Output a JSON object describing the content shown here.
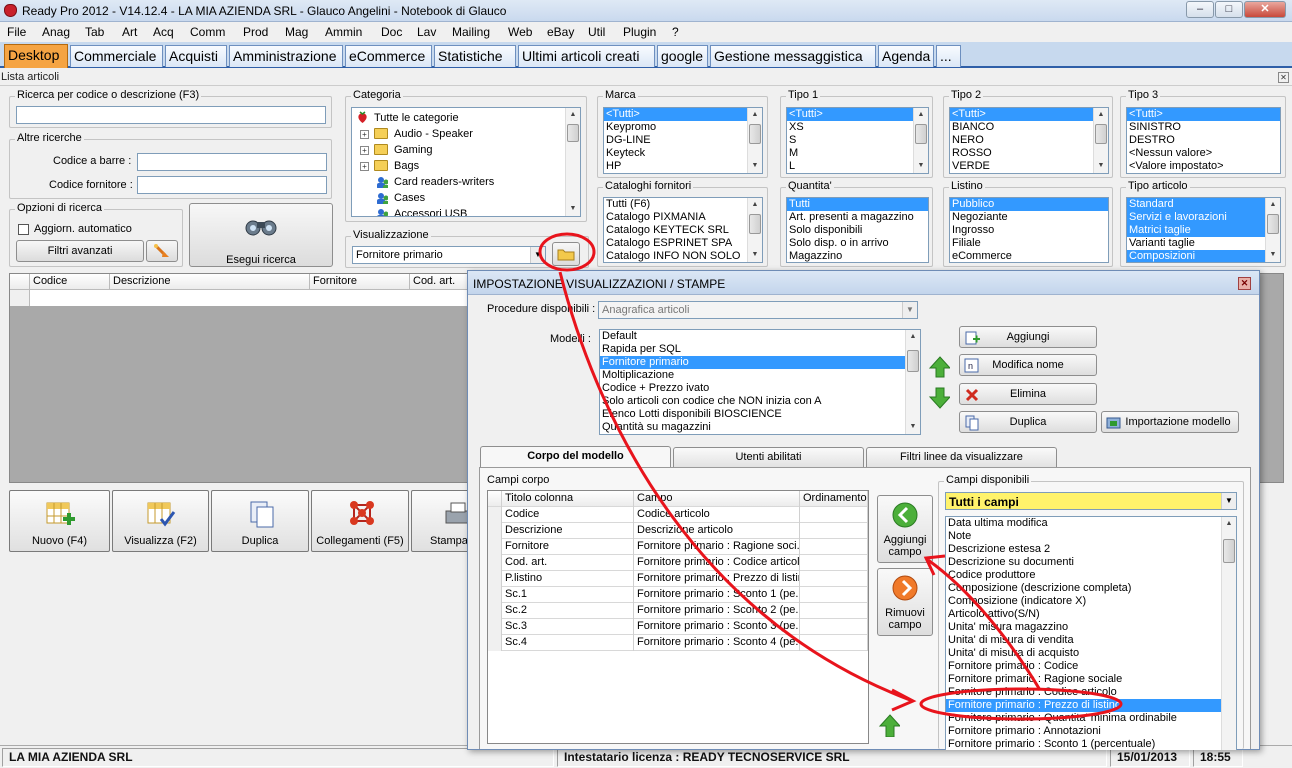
{
  "window": {
    "title": "Ready Pro 2012 - V14.12.4 - LA MIA AZIENDA SRL - Glauco Angelini - Notebook di Glauco",
    "controls": [
      "–",
      "□",
      "✕"
    ]
  },
  "menu": [
    "File",
    "Anag",
    "Tab",
    "Art",
    "Acq",
    "Comm",
    "Prod",
    "Mag",
    "Ammin",
    "Doc",
    "Lav",
    "Mailing",
    "Web",
    "eBay",
    "Util",
    "Plugin",
    "?"
  ],
  "tabs": [
    "Desktop",
    "Commerciale",
    "Acquisti",
    "Amministrazione",
    "eCommerce",
    "Statistiche",
    "Ultimi articoli creati",
    "google",
    "Gestione messaggistica",
    "Agenda",
    "..."
  ],
  "list_window": {
    "title": "Lista articoli"
  },
  "search": {
    "group_label": "Ricerca per codice o descrizione (F3)",
    "value": "",
    "other_label": "Altre ricerche",
    "barcode_label": "Codice a barre :",
    "supplier_code_label": "Codice fornitore :",
    "options_label": "Opzioni di ricerca",
    "auto_update_label": "Aggiorn. automatico",
    "advanced_filters_label": "Filtri avanzati",
    "run_label": "Esegui ricerca"
  },
  "category": {
    "label": "Categoria",
    "nodes": [
      "Tutte le categorie",
      "Audio - Speaker",
      "Gaming",
      "Bags",
      "Card readers-writers",
      "Cases",
      "Accessori USB"
    ]
  },
  "visualization": {
    "label": "Visualizzazione",
    "value": "Fornitore primario"
  },
  "filters": {
    "marca": {
      "label": "Marca",
      "items": [
        "<Tutti>",
        "Keypromo",
        "DG-LINE",
        "Keyteck",
        "HP"
      ],
      "selected": [
        0
      ]
    },
    "tipo1": {
      "label": "Tipo 1",
      "items": [
        "<Tutti>",
        "XS",
        "S",
        "M",
        "L"
      ],
      "selected": [
        0
      ]
    },
    "tipo2": {
      "label": "Tipo 2",
      "items": [
        "<Tutti>",
        "BIANCO",
        "NERO",
        "ROSSO",
        "VERDE"
      ],
      "selected": [
        0
      ]
    },
    "tipo3": {
      "label": "Tipo 3",
      "items": [
        "<Tutti>",
        "SINISTRO",
        "DESTRO",
        "<Nessun valore>",
        "<Valore impostato>"
      ],
      "selected": [
        0
      ]
    },
    "cataloghi": {
      "label": "Cataloghi fornitori",
      "items": [
        "Tutti (F6)",
        "Catalogo PIXMANIA",
        "Catalogo KEYTECK SRL",
        "Catalogo ESPRINET SPA",
        "Catalogo INFO NON SOLO"
      ],
      "selected": []
    },
    "quantita": {
      "label": "Quantita'",
      "items": [
        "Tutti",
        "Art. presenti a magazzino",
        "Solo disponibili",
        "Solo disp. o in arrivo",
        "Magazzino"
      ],
      "selected": [
        0
      ]
    },
    "listino": {
      "label": "Listino",
      "items": [
        "Pubblico",
        "Negoziante",
        "Ingrosso",
        "Filiale",
        "eCommerce"
      ],
      "selected": [
        0
      ]
    },
    "tipo_articolo": {
      "label": "Tipo articolo",
      "items": [
        "Standard",
        "Servizi e lavorazioni",
        "Matrici taglie",
        "Varianti taglie",
        "Composizioni"
      ],
      "selected": [
        0,
        1,
        2,
        4
      ]
    }
  },
  "main_grid": {
    "columns": [
      "Codice",
      "Descrizione",
      "Fornitore",
      "Cod. art."
    ]
  },
  "toolbar": [
    "Nuovo (F4)",
    "Visualizza (F2)",
    "Duplica",
    "Collegamenti (F5)",
    "Stampa"
  ],
  "status": {
    "company": "LA MIA AZIENDA SRL",
    "license": "Intestatario licenza : READY TECNOSERVICE SRL",
    "date": "15/01/2013",
    "time": "18:55"
  },
  "dialog": {
    "title": "IMPOSTAZIONE VISUALIZZAZIONI / STAMPE",
    "procedures_label": "Procedure disponibili :",
    "procedures_value": "Anagrafica articoli",
    "models_label": "Modelli :",
    "models": [
      "Default",
      "Rapida per SQL",
      "Fornitore primario",
      "Moltiplicazione",
      "Codice + Prezzo ivato",
      "Solo articoli con codice che NON inizia con A",
      "Elenco Lotti disponibili BIOSCIENCE",
      "Quantità su magazzini"
    ],
    "selected_model": 2,
    "buttons": {
      "add": "Aggiungi",
      "rename": "Modifica nome",
      "delete": "Elimina",
      "duplicate": "Duplica",
      "import": "Importazione modello"
    },
    "tabs": [
      "Corpo del modello",
      "Utenti abilitati",
      "Filtri linee da visualizzare"
    ],
    "body_fields_label": "Campi corpo",
    "body_columns": [
      "Titolo colonna",
      "Campo",
      "Ordinamento"
    ],
    "body_rows": [
      [
        "Codice",
        "Codice articolo",
        ""
      ],
      [
        "Descrizione",
        "Descrizione articolo",
        ""
      ],
      [
        "Fornitore",
        "Fornitore primario : Ragione soci...",
        ""
      ],
      [
        "Cod. art.",
        "Fornitore primario : Codice articolo",
        ""
      ],
      [
        "P.listino",
        "Fornitore primario : Prezzo di listino",
        ""
      ],
      [
        "Sc.1",
        "Fornitore primario : Sconto 1 (pe...",
        ""
      ],
      [
        "Sc.2",
        "Fornitore primario : Sconto 2 (pe...",
        ""
      ],
      [
        "Sc.3",
        "Fornitore primario : Sconto 3 (pe...",
        ""
      ],
      [
        "Sc.4",
        "Fornitore primario : Sconto 4 (pe...",
        ""
      ]
    ],
    "add_field_label": "Aggiungi campo",
    "remove_field_label": "Rimuovi campo",
    "available_label": "Campi disponibili",
    "available_filter": "Tutti i campi",
    "available_fields": [
      "Data ultima modifica",
      "Note",
      "Descrizione estesa 2",
      "Descrizione su documenti",
      "Codice produttore",
      "Composizione (descrizione completa)",
      "Composizione (indicatore X)",
      "Articolo attivo(S/N)",
      "Unita' misura magazzino",
      "Unita' di misura di vendita",
      "Unita' di misura di acquisto",
      "Fornitore primario : Codice",
      "Fornitore primario : Ragione sociale",
      "Fornitore primario : Codice articolo",
      "Fornitore primario : Prezzo di listino",
      "Fornitore primario : Quantita' minima ordinabile",
      "Fornitore primario : Annotazioni",
      "Fornitore primario : Sconto 1 (percentuale)"
    ],
    "selected_available": 14
  },
  "colors": {
    "accent": "#3399ff",
    "annotation": "#e8141c",
    "active_tab": "#f5a443",
    "filter_combo": "#fff36b"
  }
}
